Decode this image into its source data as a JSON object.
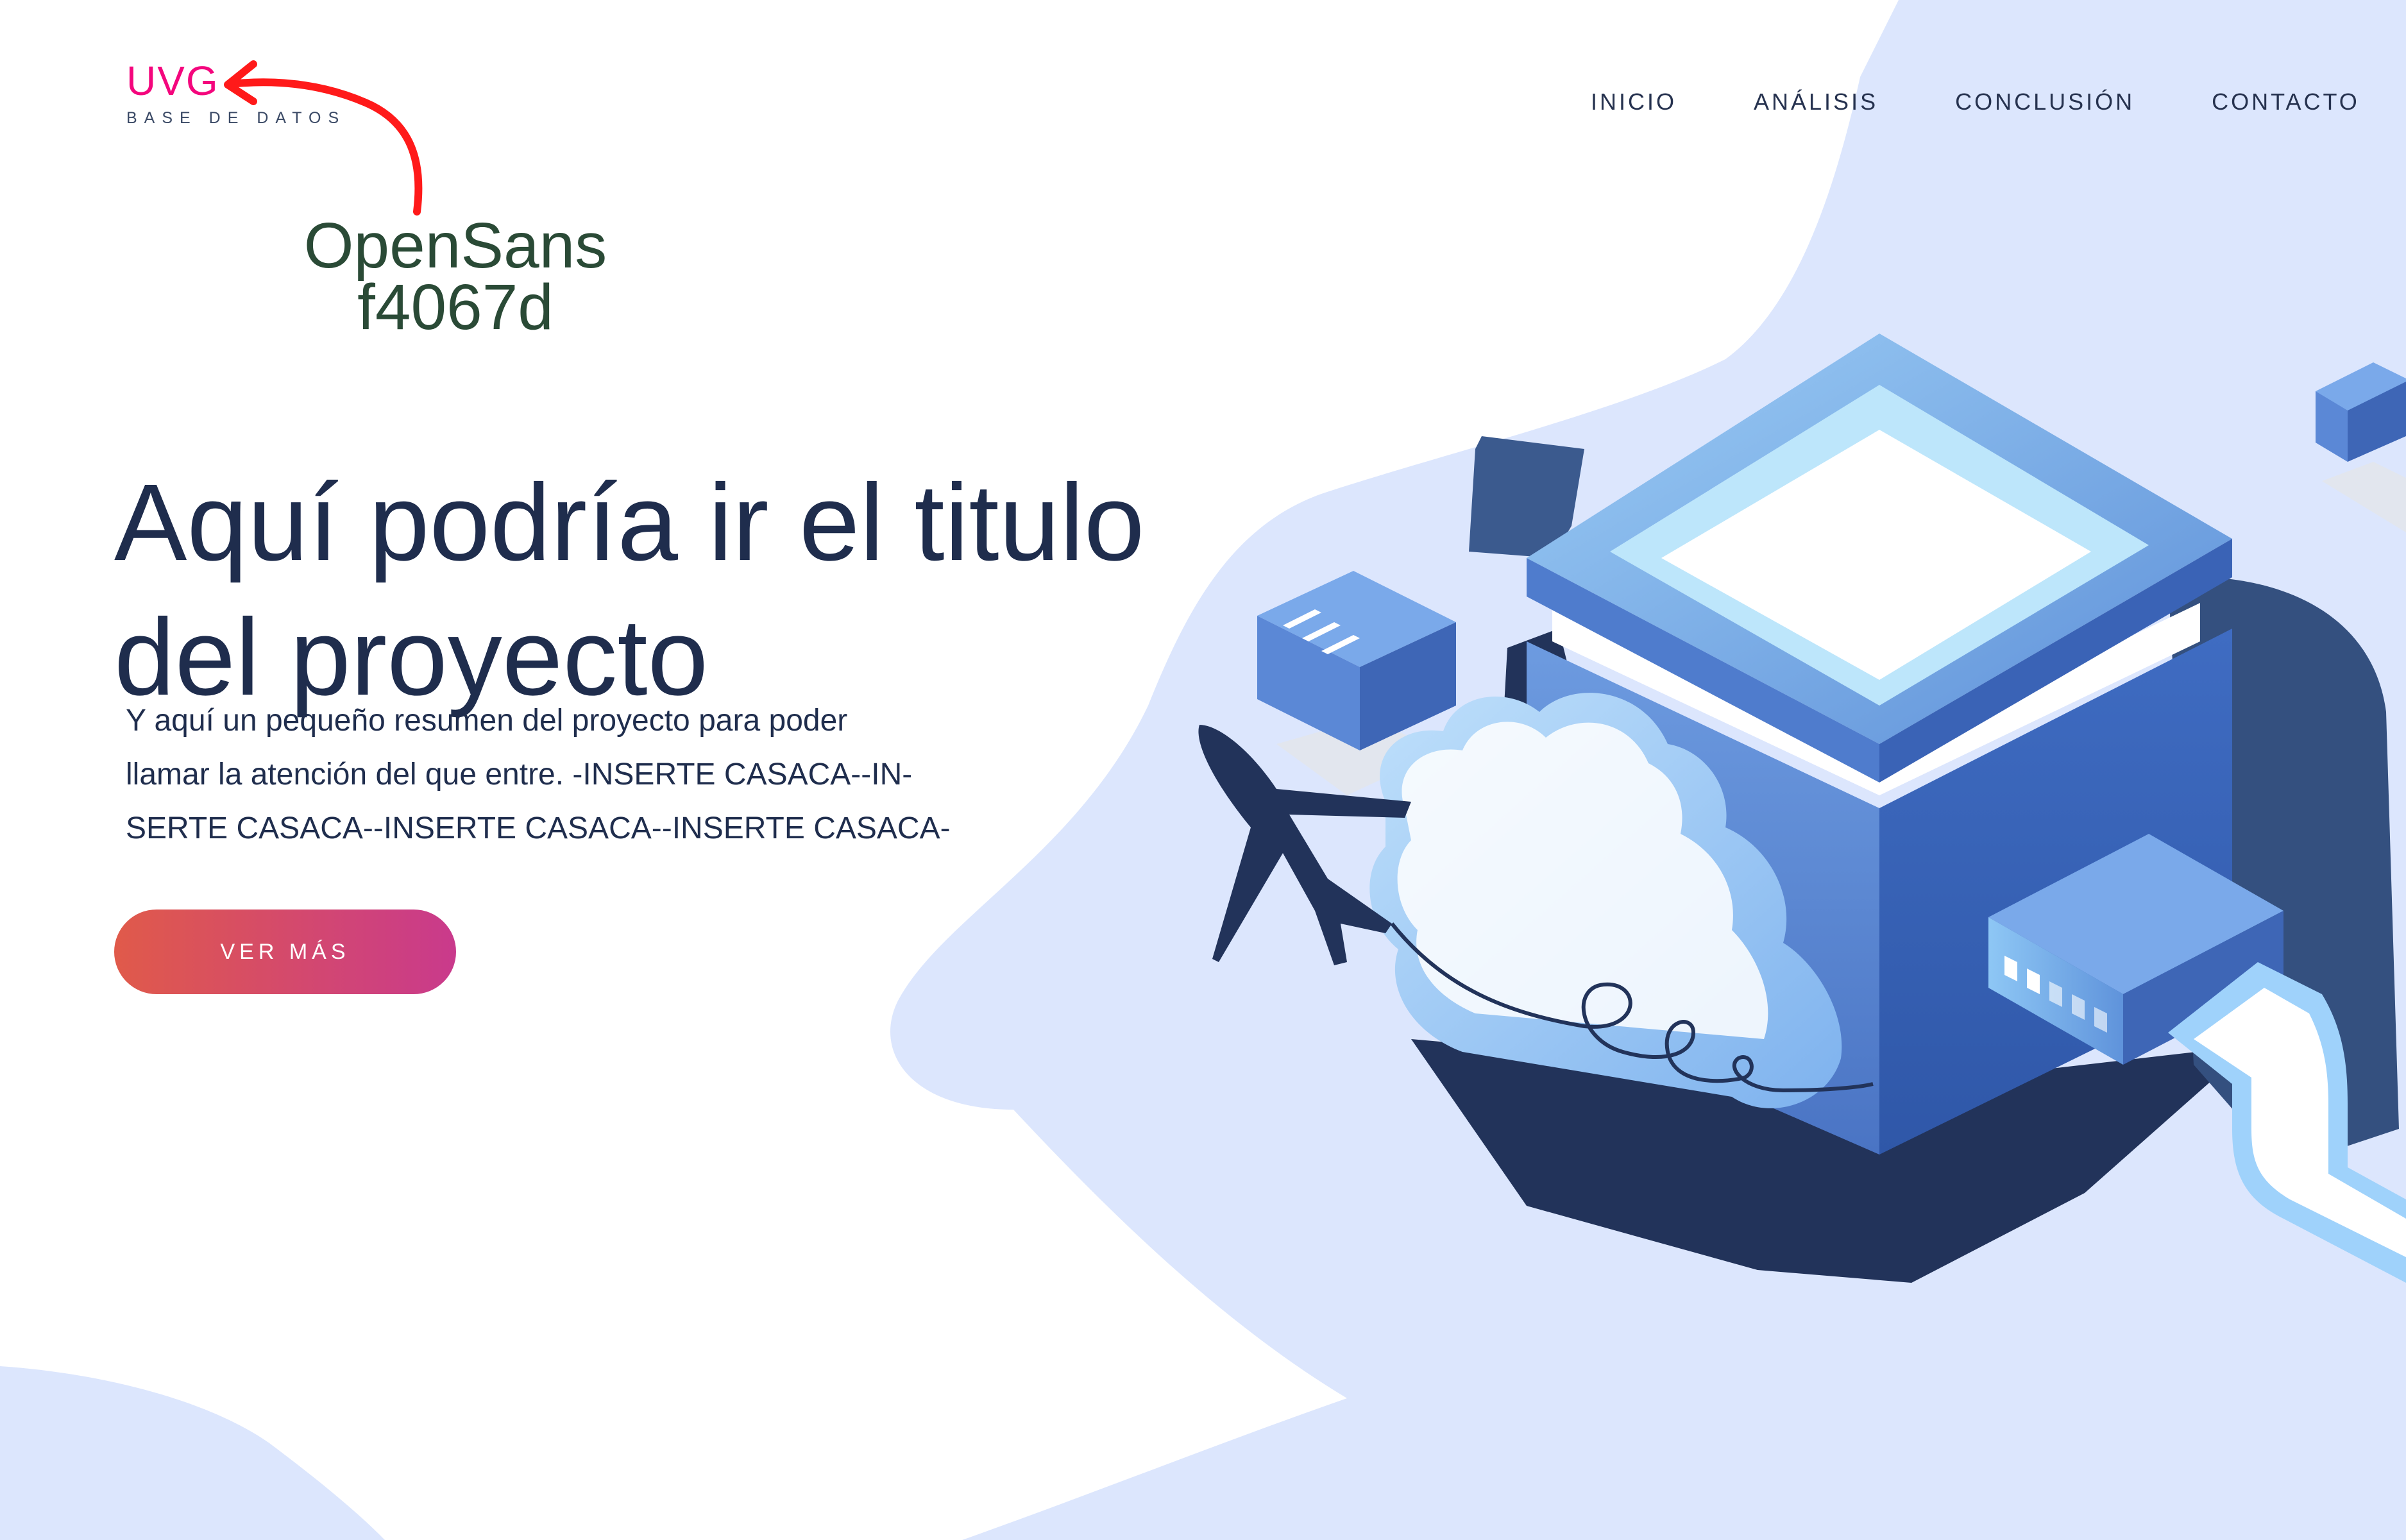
{
  "header": {
    "logo_mark": "UVG",
    "logo_sub": "BASE DE DATOS"
  },
  "annotation": {
    "font_name": "OpenSans",
    "color_code": "f4067d"
  },
  "nav": {
    "items": [
      {
        "label": "INICIO"
      },
      {
        "label": "ANÁLISIS"
      },
      {
        "label": "CONCLUSIÓN"
      },
      {
        "label": "CONTACTO"
      }
    ]
  },
  "hero": {
    "title_line1": "Aquí podría ir el titulo",
    "title_line2": "del proyecto",
    "summary_line1": "Y aquí un pequeño resumen del proyecto para poder",
    "summary_line2": "llamar la atención del que entre. -INSERTE CASACA--IN-",
    "summary_line3": "SERTE CASACA--INSERTE CASACA--INSERTE CASACA-",
    "cta_label": "VER MÁS"
  },
  "colors": {
    "brand": "#f4067d",
    "annotation_arrow": "#ff1a1a",
    "navy": "#1f2d4d",
    "blob": "#dce6fd",
    "cta_start": "#e05a4a",
    "cta_end": "#c93a8c"
  },
  "icons": {
    "arrow": "curved-arrow-icon",
    "illustration": "server-cloud-illustration"
  }
}
